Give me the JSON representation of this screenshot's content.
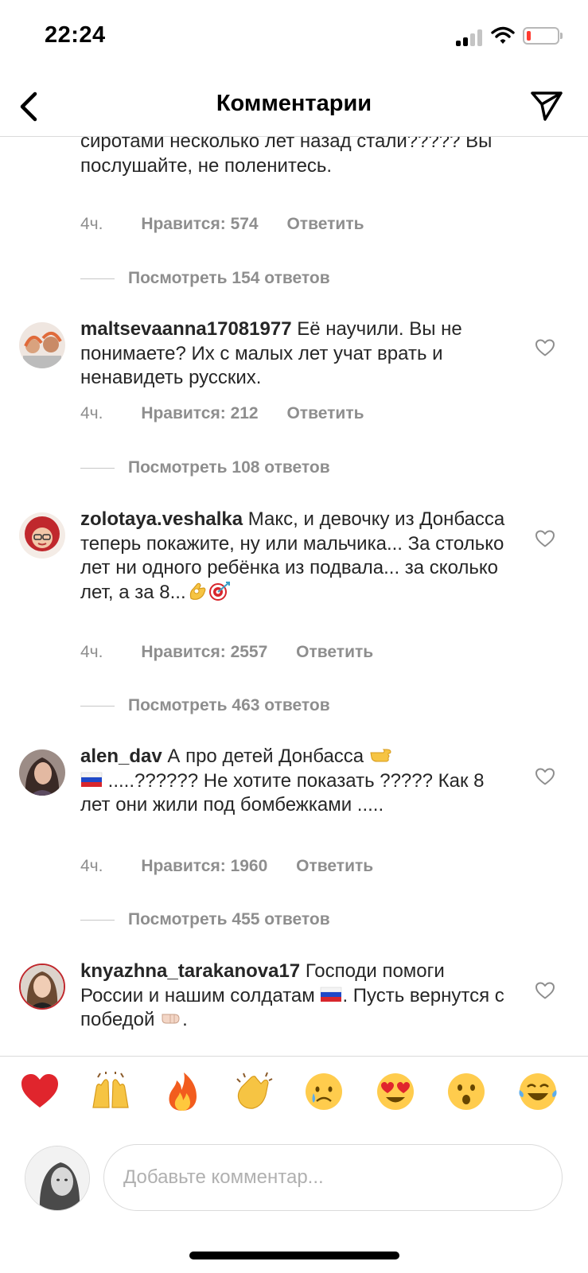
{
  "status": {
    "time": "22:24"
  },
  "header": {
    "title": "Комментарии"
  },
  "comments": [
    {
      "text": "сиротами несколько лет назад стали????? Вы послушайте, не поленитесь.",
      "time": "4ч.",
      "likes": "Нравится: 574",
      "reply": "Ответить",
      "view_replies": "Посмотреть 154 ответов"
    },
    {
      "username": "maltsevaanna17081977",
      "text": "Её научили. Вы не понимаете? Их с малых лет учат врать и ненавидеть русских.",
      "time": "4ч.",
      "likes": "Нравится: 212",
      "reply": "Ответить",
      "view_replies": "Посмотреть 108 ответов"
    },
    {
      "username": "zolotaya.veshalka",
      "text": "Макс, и девочку из Донбасса теперь покажите, ну или мальчика... За столько лет ни одного ребёнка из  подвала... за сколько лет, а за 8...",
      "emojis": [
        "ok-hand-emoji",
        "target-emoji"
      ],
      "time": "4ч.",
      "likes": "Нравится: 2557",
      "reply": "Ответить",
      "view_replies": "Посмотреть 463 ответов"
    },
    {
      "username": "alen_dav",
      "text_before": "А про детей Донбасса",
      "text_after": ".....?????? Не хотите показать ????? Как 8 лет они жили под бомбежками .....",
      "emojis": [
        "pointing-right-emoji",
        "russia-flag-emoji"
      ],
      "time": "4ч.",
      "likes": "Нравится: 1960",
      "reply": "Ответить",
      "view_replies": "Посмотреть 455 ответов"
    },
    {
      "username": "knyazhna_tarakanova17",
      "text_before": "Господи помоги России и нашим солдатам",
      "text_middle": ". Пусть вернутся с победой",
      "text_after": ".",
      "emojis": [
        "russia-flag-emoji",
        "fist-emoji"
      ]
    }
  ],
  "reactions": [
    "red-heart",
    "raising-hands",
    "fire",
    "clapping-hands",
    "crying-face",
    "heart-eyes",
    "surprised-face",
    "tears-of-joy"
  ],
  "composer": {
    "placeholder": "Добавьте комментар..."
  },
  "colors": {
    "text": "#262626",
    "meta": "#8e8e8e",
    "divider": "#dbdbdb",
    "heart": "#ff3b30"
  }
}
